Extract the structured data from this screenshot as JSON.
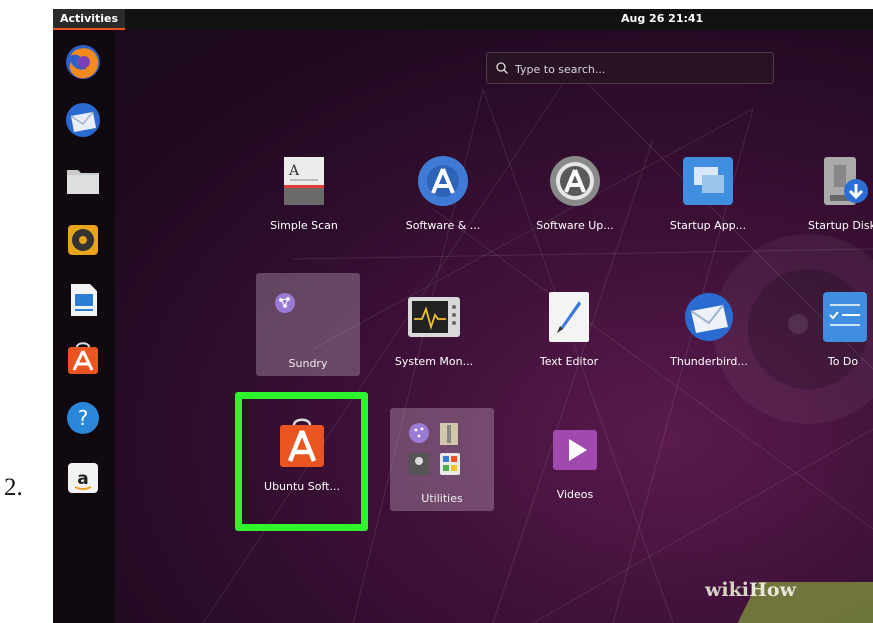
{
  "step_number": "2.",
  "topbar": {
    "activities": "Activities",
    "clock": "Aug 26  21:41"
  },
  "dock": {
    "items": [
      {
        "name": "firefox-icon"
      },
      {
        "name": "thunderbird-icon"
      },
      {
        "name": "files-icon"
      },
      {
        "name": "rhythmbox-icon"
      },
      {
        "name": "libreoffice-writer-icon"
      },
      {
        "name": "ubuntu-software-icon"
      },
      {
        "name": "help-icon"
      },
      {
        "name": "amazon-icon"
      }
    ]
  },
  "search": {
    "placeholder": "Type to search..."
  },
  "apps": {
    "simple_scan": "Simple Scan",
    "software_sources": "Software & ...",
    "software_updater": "Software Up...",
    "startup_apps": "Startup App...",
    "startup_disk": "Startup Disk",
    "sundry": "Sundry",
    "system_monitor": "System Mon...",
    "text_editor": "Text Editor",
    "thunderbird": "Thunderbird...",
    "todo": "To Do",
    "ubuntu_software": "Ubuntu Soft...",
    "utilities": "Utilities",
    "videos": "Videos"
  },
  "watermark": {
    "part1": "wiki",
    "part2": "How"
  },
  "colors": {
    "highlight": "#2ef52e",
    "ubuntu_orange": "#e95420",
    "software_blue": "#3f7bd6"
  }
}
